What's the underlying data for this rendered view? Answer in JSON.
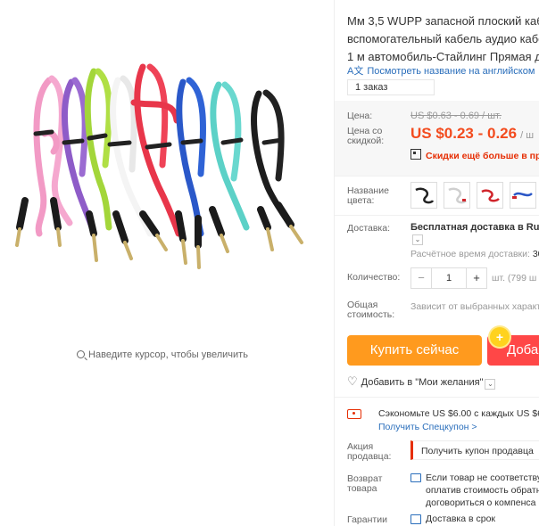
{
  "gallery": {
    "zoom_hint": "Наведите курсор, чтобы увеличить"
  },
  "product": {
    "title_lines": [
      "Мм 3,5 WUPP запасной плоский кабе",
      "вспомогательный кабель аудио кабе",
      "1 м автомобиль-Стайлинг Прямая до"
    ],
    "translate_link": "Посмотреть название на английском",
    "orders": "1 заказ"
  },
  "price": {
    "price_label": "Цена:",
    "old_price": "US $0.63 - 0.69 / шт.",
    "discount_label_1": "Цена со",
    "discount_label_2": "скидкой:",
    "new_price": "US $0.23 - 0.26",
    "new_price_unit": "/ ш",
    "promo": "Скидки ещё больше в при"
  },
  "options": {
    "color_label_1": "Название",
    "color_label_2": "цвета:",
    "swatch_colors": [
      "#222222",
      "#dddddd",
      "#d0252b",
      "#2a56c6",
      "#2a56c6"
    ],
    "shipping_label": "Доставка:",
    "shipping_value": "Бесплатная доставка в Russ",
    "shipping_time_label": "Расчётное время доставки:",
    "shipping_time_value": "30",
    "quantity_label": "Количество:",
    "quantity_value": "1",
    "quantity_minus": "−",
    "quantity_plus": "+",
    "quantity_unit": "шт. (799 ш",
    "total_label_1": "Общая",
    "total_label_2": "стоимость:",
    "total_value": "Зависит от выбранных характ"
  },
  "actions": {
    "buy_now": "Купить сейчас",
    "add_to_cart": "Доба",
    "wishlist": "Добавить в \"Мои желания\""
  },
  "coupons": {
    "saving_text": "Сэкономьте US $6.00 с каждых US $65",
    "special_coupon_link": "Получить Спецкупон >",
    "seller_promo_label_1": "Акция",
    "seller_promo_label_2": "продавца:",
    "seller_coupon_button": "Получить купон продавца"
  },
  "service": {
    "return_label_1": "Возврат",
    "return_label_2": "товара",
    "return_line_1": "Если товар не соответству",
    "return_line_2": "оплатив стоимость обратн",
    "return_line_3": "договориться о компенса",
    "guarantee_label": "Гарантии",
    "guarantee_value": "Доставка в срок"
  },
  "colors": {
    "accent_orange": "#ff9a1e",
    "accent_red": "#ff4747",
    "price_red": "#f34b1e",
    "link_blue": "#2a6ebb"
  }
}
